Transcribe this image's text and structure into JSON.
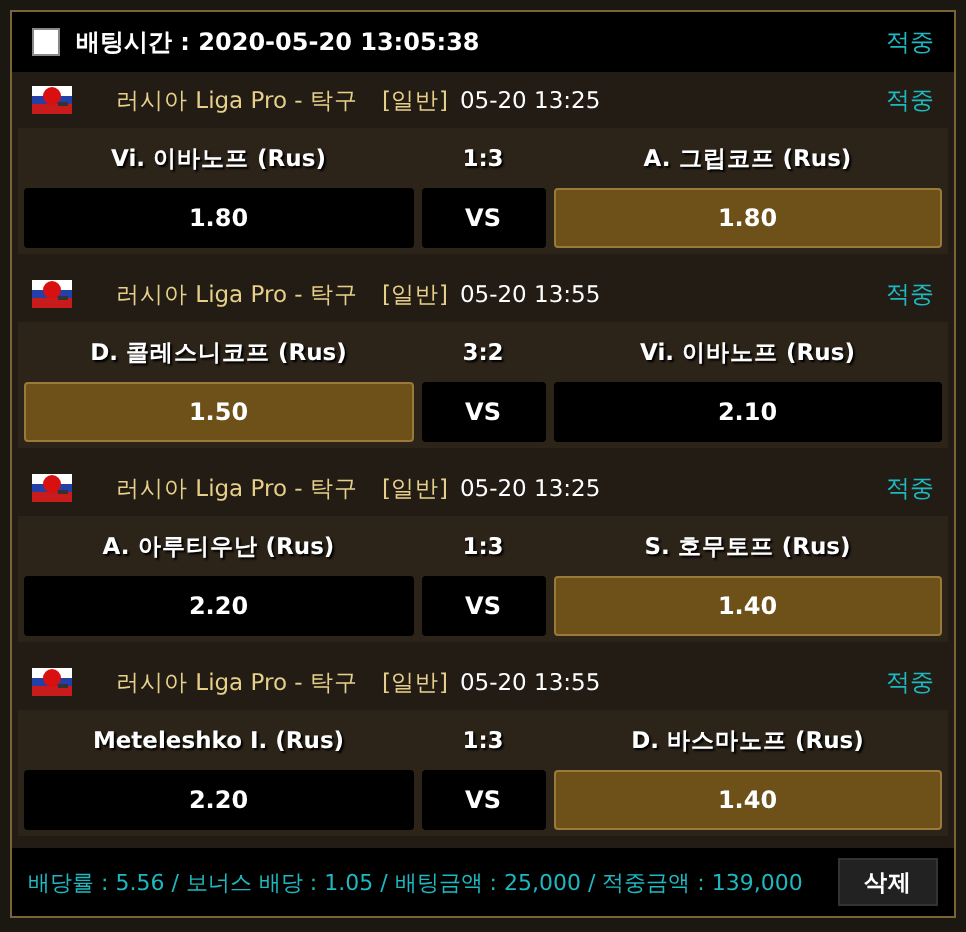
{
  "header": {
    "checked": false,
    "bet_time": "배팅시간 : 2020-05-20 13:05:38",
    "result": "적중"
  },
  "matches": [
    {
      "league": "러시아 Liga Pro - 탁구",
      "type": "[일반]",
      "time": "05-20 13:25",
      "result": "적중",
      "home": "Vi. 이바노프 (Rus)",
      "score": "1:3",
      "away": "A. 그립코프 (Rus)",
      "home_odds": "1.80",
      "vs": "VS",
      "away_odds": "1.80",
      "home_selected": false,
      "away_selected": true
    },
    {
      "league": "러시아 Liga Pro - 탁구",
      "type": "[일반]",
      "time": "05-20 13:55",
      "result": "적중",
      "home": "D. 콜레스니코프 (Rus)",
      "score": "3:2",
      "away": "Vi. 이바노프 (Rus)",
      "home_odds": "1.50",
      "vs": "VS",
      "away_odds": "2.10",
      "home_selected": true,
      "away_selected": false
    },
    {
      "league": "러시아 Liga Pro - 탁구",
      "type": "[일반]",
      "time": "05-20 13:25",
      "result": "적중",
      "home": "A. 아루티우난 (Rus)",
      "score": "1:3",
      "away": "S. 호무토프 (Rus)",
      "home_odds": "2.20",
      "vs": "VS",
      "away_odds": "1.40",
      "home_selected": false,
      "away_selected": true
    },
    {
      "league": "러시아 Liga Pro - 탁구",
      "type": "[일반]",
      "time": "05-20 13:55",
      "result": "적중",
      "home": "Meteleshko I. (Rus)",
      "score": "1:3",
      "away": "D. 바스마노프 (Rus)",
      "home_odds": "2.20",
      "vs": "VS",
      "away_odds": "1.40",
      "home_selected": false,
      "away_selected": true
    }
  ],
  "footer": {
    "summary": "배당률 : 5.56 / 보너스 배당 : 1.05 / 배팅금액 : 25,000 / 적중금액 : 139,000",
    "delete_button": "삭제"
  }
}
